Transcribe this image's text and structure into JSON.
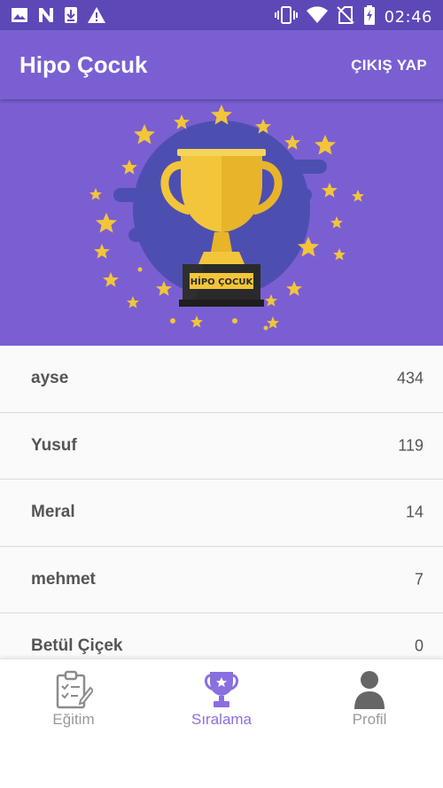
{
  "status_bar": {
    "time": "02:46",
    "icons": [
      "image-icon",
      "n-app-icon",
      "download-icon",
      "warning-icon",
      "vibrate-icon",
      "wifi-icon",
      "no-sim-icon",
      "battery-charging-icon"
    ]
  },
  "app_bar": {
    "title": "Hipo Çocuk",
    "logout_label": "ÇIKIŞ YAP"
  },
  "hero": {
    "trophy_plate_text": "HİPO ÇOCUK",
    "icon": "trophy-icon"
  },
  "ranking": [
    {
      "name": "ayse",
      "score": "434"
    },
    {
      "name": "Yusuf",
      "score": "119"
    },
    {
      "name": "Meral",
      "score": "14"
    },
    {
      "name": "mehmet",
      "score": "7"
    },
    {
      "name": "Betül Çiçek",
      "score": "0"
    }
  ],
  "bottom_nav": {
    "items": [
      {
        "label": "Eğitim",
        "icon": "clipboard-icon",
        "active": false
      },
      {
        "label": "Sıralama",
        "icon": "trophy-icon",
        "active": true
      },
      {
        "label": "Profil",
        "icon": "person-icon",
        "active": false
      }
    ]
  },
  "colors": {
    "status_bar": "#5e48b8",
    "primary": "#7a5fd3",
    "hero_circle": "#4d4fb0",
    "star": "#f2c53a",
    "accent_active": "#8a6fe0",
    "inactive": "#9a9a9a"
  }
}
